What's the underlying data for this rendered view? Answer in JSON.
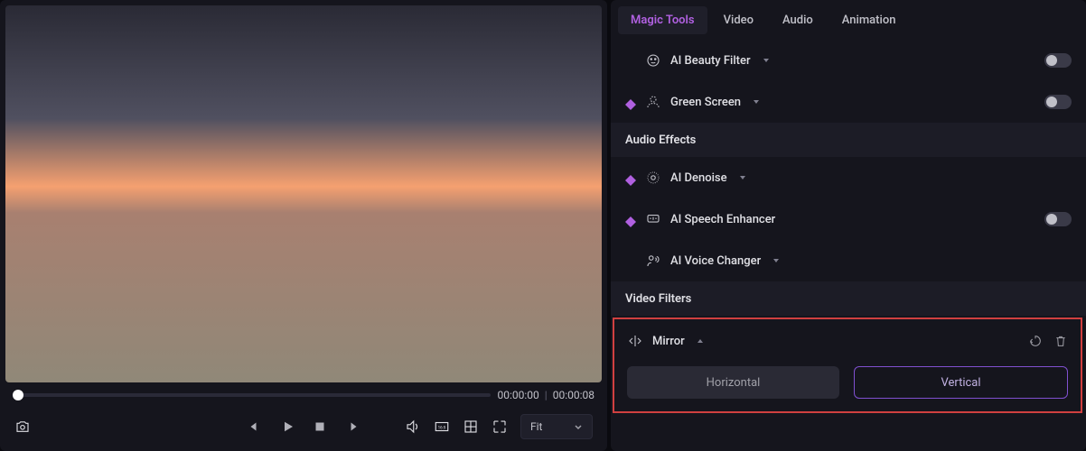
{
  "preview": {
    "current_time": "00:00:00",
    "total_time": "00:00:08",
    "fit_label": "Fit"
  },
  "tabs": [
    "Magic Tools",
    "Video",
    "Audio",
    "Animation"
  ],
  "active_tab": "Magic Tools",
  "filters": {
    "ai_beauty": {
      "label": "AI Beauty Filter",
      "premium": false,
      "toggle": false
    },
    "green_screen": {
      "label": "Green Screen",
      "premium": true,
      "toggle": false
    },
    "ai_denoise": {
      "label": "AI Denoise",
      "premium": true
    },
    "ai_speech": {
      "label": "AI Speech Enhancer",
      "premium": true,
      "toggle": false
    },
    "ai_voice": {
      "label": "AI Voice Changer",
      "premium": false
    }
  },
  "sections": {
    "audio_effects": "Audio Effects",
    "video_filters": "Video Filters"
  },
  "mirror": {
    "label": "Mirror",
    "horizontal": "Horizontal",
    "vertical": "Vertical",
    "selected": "Vertical"
  }
}
